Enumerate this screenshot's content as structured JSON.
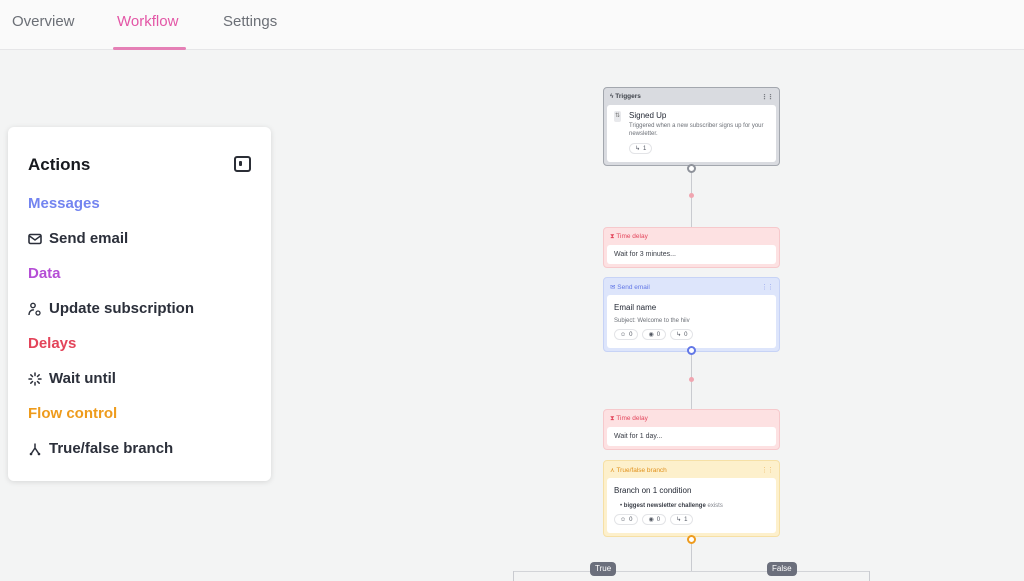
{
  "tabs": [
    {
      "label": "Overview",
      "active": false
    },
    {
      "label": "Workflow",
      "active": true
    },
    {
      "label": "Settings",
      "active": false
    }
  ],
  "colors": {
    "accent": "#e356a6",
    "messages": "#7384f0",
    "data": "#b54ed6",
    "delays": "#e3445a",
    "flow_control": "#ee9b1c"
  },
  "actions_panel": {
    "title": "Actions",
    "collapse_icon": "sidebar-collapse-icon",
    "groups": [
      {
        "label": "Messages",
        "items": [
          {
            "label": "Send email",
            "icon": "mail-icon"
          }
        ]
      },
      {
        "label": "Data",
        "items": [
          {
            "label": "Update subscription",
            "icon": "user-gear-icon"
          }
        ]
      },
      {
        "label": "Delays",
        "items": [
          {
            "label": "Wait until",
            "icon": "loader-icon"
          }
        ]
      },
      {
        "label": "Flow control",
        "items": [
          {
            "label": "True/false branch",
            "icon": "branch-icon"
          }
        ]
      }
    ]
  },
  "workflow": {
    "trigger": {
      "header": "Triggers",
      "title": "Signed Up",
      "description": "Triggered when a new subscriber signs up for your newsletter.",
      "count": "1"
    },
    "delay1": {
      "header": "Time delay",
      "text": "Wait for 3 minutes..."
    },
    "email": {
      "header": "Send email",
      "title": "Email name",
      "subject": "Subject: Welcome to the hiiv",
      "stats": [
        "0",
        "0",
        "0"
      ]
    },
    "delay2": {
      "header": "Time delay",
      "text": "Wait for 1 day..."
    },
    "branch": {
      "header": "True/false branch",
      "title": "Branch on 1 condition",
      "condition_field": "biggest newsletter challenge",
      "condition_op": "exists",
      "stats": [
        "0",
        "0",
        "1"
      ],
      "true_label": "True",
      "false_label": "False"
    }
  }
}
